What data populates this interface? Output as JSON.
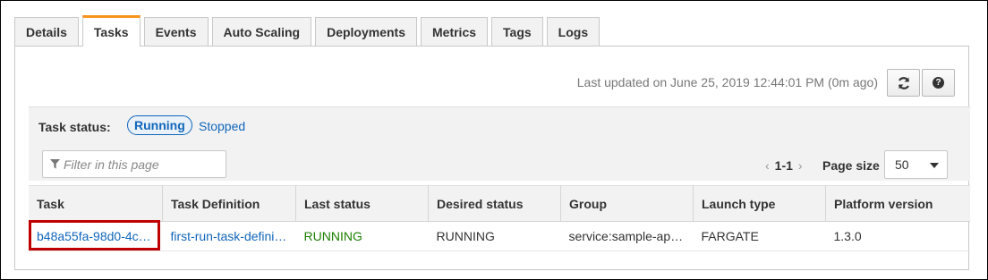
{
  "tabs": [
    {
      "label": "Details",
      "active": false
    },
    {
      "label": "Tasks",
      "active": true
    },
    {
      "label": "Events",
      "active": false
    },
    {
      "label": "Auto Scaling",
      "active": false
    },
    {
      "label": "Deployments",
      "active": false
    },
    {
      "label": "Metrics",
      "active": false
    },
    {
      "label": "Tags",
      "active": false
    },
    {
      "label": "Logs",
      "active": false
    }
  ],
  "toolbar": {
    "last_updated": "Last updated on June 25, 2019 12:44:01 PM (0m ago)",
    "refresh_icon": "refresh-icon",
    "help_icon": "help-icon",
    "help_glyph": "?"
  },
  "status_filter": {
    "label": "Task status:",
    "selected": "Running",
    "other": "Stopped"
  },
  "search": {
    "placeholder": "Filter in this page"
  },
  "pagination": {
    "prev": "‹",
    "range": "1-1",
    "next": "›",
    "page_size_label": "Page size",
    "page_size_value": "50"
  },
  "table": {
    "columns": [
      "Task",
      "Task Definition",
      "Last status",
      "Desired status",
      "Group",
      "Launch type",
      "Platform version"
    ],
    "rows": [
      {
        "task": "b48a55fa-98d0-4c…",
        "task_definition": "first-run-task-defini…",
        "last_status": "RUNNING",
        "desired_status": "RUNNING",
        "group": "service:sample-ap…",
        "launch_type": "FARGATE",
        "platform_version": "1.3.0"
      }
    ]
  },
  "colors": {
    "accent_tab": "#f7941d",
    "link": "#1166bb",
    "running": "#1d8102",
    "highlight": "#c00000"
  }
}
